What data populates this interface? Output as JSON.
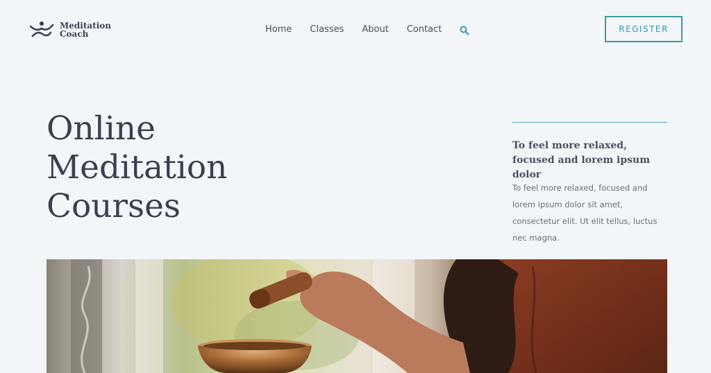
{
  "brand": {
    "line1": "Meditation",
    "line2": "Coach"
  },
  "nav": {
    "items": [
      {
        "label": "Home"
      },
      {
        "label": "Classes"
      },
      {
        "label": "About"
      },
      {
        "label": "Contact"
      }
    ],
    "search_icon": "search-icon"
  },
  "register": {
    "label": "REGISTER"
  },
  "hero": {
    "title_lines": [
      "Online",
      "Meditation",
      "Courses"
    ],
    "subheading": "To feel more relaxed, focused and lorem ipsum dolor",
    "body": "To feel more relaxed, focused and lorem ipsum dolor sit amet, consectetur elit. Ut elit tellus, luctus nec magna."
  },
  "colors": {
    "accent": "#3a98a8",
    "background": "#f2f6f9",
    "heading": "#3b3f4e"
  }
}
